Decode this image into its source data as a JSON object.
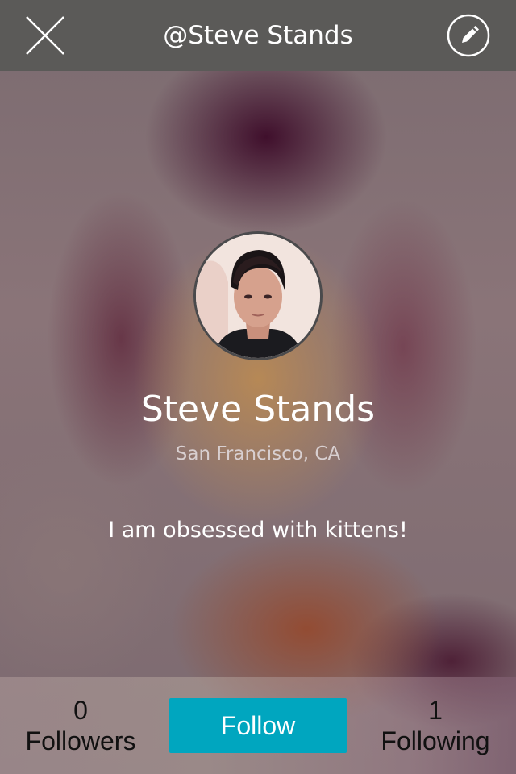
{
  "header": {
    "title": "@Steve Stands",
    "close_icon": "close-icon",
    "edit_icon": "pencil-icon"
  },
  "profile": {
    "name": "Steve Stands",
    "location": "San Francisco, CA",
    "bio": "I am obsessed with kittens!"
  },
  "stats": {
    "followers_count": "0",
    "followers_label": "Followers",
    "following_count": "1",
    "following_label": "Following"
  },
  "actions": {
    "follow_label": "Follow"
  },
  "colors": {
    "header_bg": "#5b5a58",
    "follow_button": "#00a6bf"
  }
}
